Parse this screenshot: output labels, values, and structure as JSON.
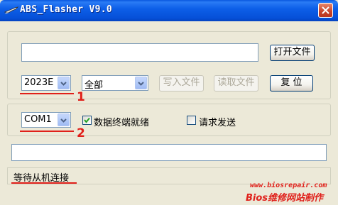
{
  "window": {
    "title": "ABS_Flasher V9.0"
  },
  "file_path": {
    "value": "",
    "open_label": "打开文件"
  },
  "model_select": {
    "value": "2023E"
  },
  "range_select": {
    "value": "全部"
  },
  "buttons": {
    "write_label": "写入文件",
    "read_label": "读取文件",
    "reset_label": "复 位"
  },
  "port_select": {
    "value": "COM1"
  },
  "data_terminal_ready": {
    "label": "数据终端就绪",
    "checked": true
  },
  "request_to_send": {
    "label": "请求发送",
    "checked": false
  },
  "progress_field": {
    "value": ""
  },
  "status": {
    "text": "等待从机连接"
  },
  "annotations": {
    "marker_1": "1",
    "marker_2": "2"
  },
  "watermark": {
    "url": "www.biosrepair.com",
    "brand": "Bios维修网站制作"
  },
  "colors": {
    "title_bar": "#0A58E0",
    "annotation": "#E0201A",
    "background": "#ECE9D8"
  }
}
